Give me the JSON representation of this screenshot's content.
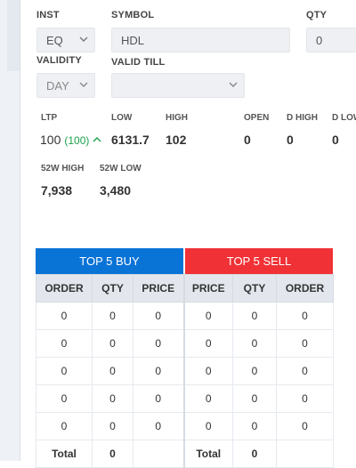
{
  "form": {
    "inst_label": "INST",
    "symbol_label": "SYMBOL",
    "qty_label": "QTY",
    "validity_label": "VALIDITY",
    "valid_till_label": "VALID TILL",
    "inst_value": "EQ",
    "symbol_value": "HDL",
    "qty_value": "0",
    "validity_value": "DAY",
    "valid_till_value": ""
  },
  "quote": {
    "ltp_label": "LTP",
    "low_label": "LOW",
    "high_label": "HIGH",
    "open_label": "OPEN",
    "dhigh_label": "D HIGH",
    "dlow_label": "D LOW",
    "ltp_value": "100",
    "ltp_change": "(100)",
    "low_value": "6131.7",
    "high_value": "102",
    "open_value": "0",
    "dhigh_value": "0",
    "dlow_value": "0",
    "w52_high_label": "52W HIGH",
    "w52_low_label": "52W LOW",
    "w52_high_value": "7,938",
    "w52_low_value": "3,480",
    "change_color": "#1aa34a"
  },
  "depth": {
    "buy_title": "TOP 5 BUY",
    "sell_title": "TOP 5 SELL",
    "buy_color": "#0a73d6",
    "sell_color": "#f03236",
    "columns": [
      "ORDER",
      "QTY",
      "PRICE",
      "PRICE",
      "QTY",
      "ORDER"
    ],
    "rows": [
      [
        "0",
        "0",
        "0",
        "0",
        "0",
        "0"
      ],
      [
        "0",
        "0",
        "0",
        "0",
        "0",
        "0"
      ],
      [
        "0",
        "0",
        "0",
        "0",
        "0",
        "0"
      ],
      [
        "0",
        "0",
        "0",
        "0",
        "0",
        "0"
      ],
      [
        "0",
        "0",
        "0",
        "0",
        "0",
        "0"
      ]
    ],
    "total_label": "Total",
    "buy_total_qty": "0",
    "sell_total_qty": "0"
  }
}
